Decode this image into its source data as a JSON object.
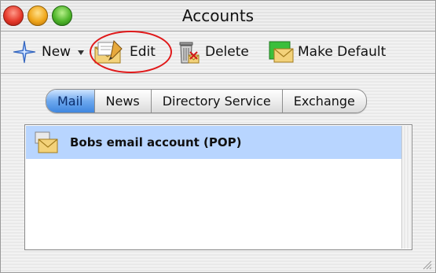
{
  "window": {
    "title": "Accounts"
  },
  "toolbar": {
    "new_label": "New",
    "edit_label": "Edit",
    "delete_label": "Delete",
    "make_default_label": "Make Default"
  },
  "tabs": [
    {
      "label": "Mail",
      "active": true
    },
    {
      "label": "News",
      "active": false
    },
    {
      "label": "Directory Service",
      "active": false
    },
    {
      "label": "Exchange",
      "active": false
    }
  ],
  "accounts": [
    {
      "name": "Bobs email account (POP)",
      "selected": true
    }
  ],
  "colors": {
    "selection": "#b8d5ff",
    "annotation_ring": "#e0191a",
    "active_tab": "#3f86df"
  },
  "icons": {
    "new": "sparkle-star-icon",
    "edit": "edit-pencil-envelope-icon",
    "delete": "trash-can-icon",
    "make_default": "green-envelope-icon",
    "account": "envelope-icon"
  }
}
